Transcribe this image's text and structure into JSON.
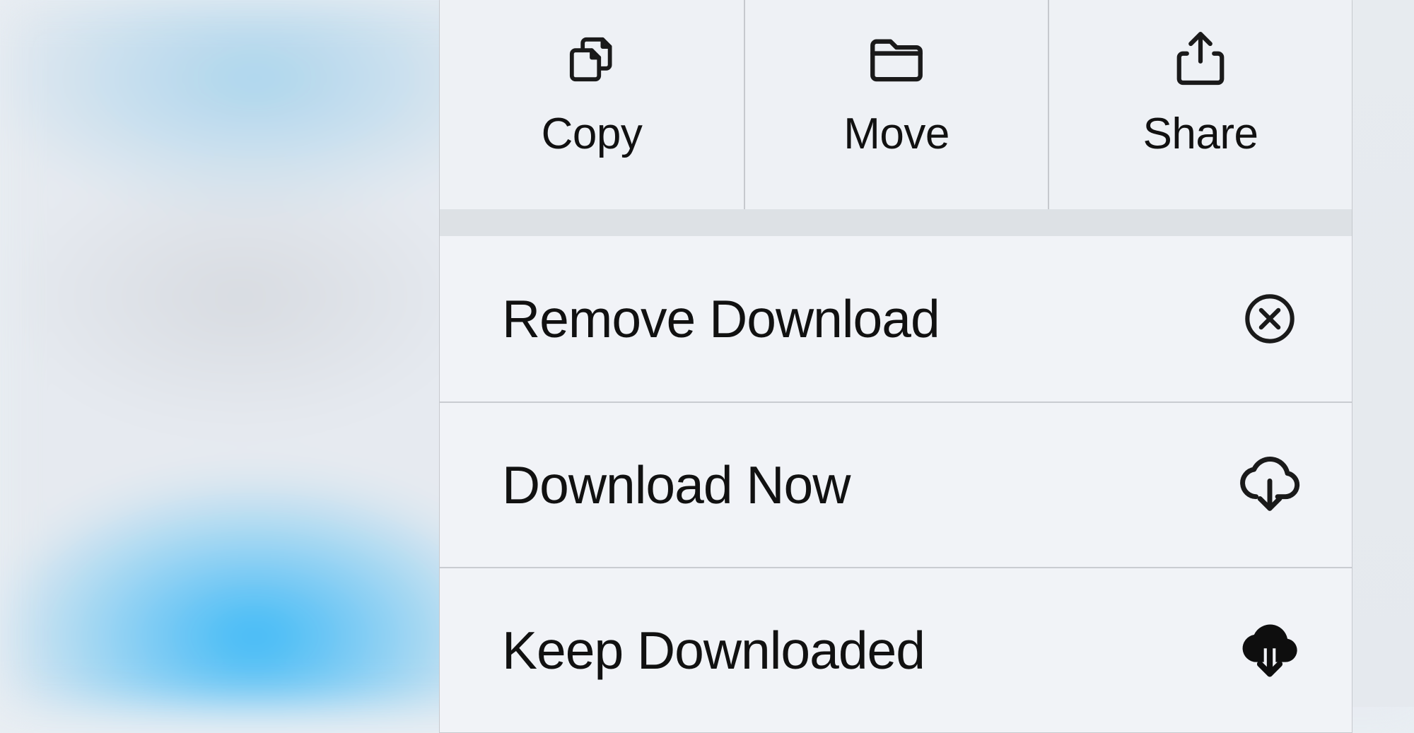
{
  "menu": {
    "top": {
      "copy": {
        "label": "Copy",
        "icon": "copy-icon"
      },
      "move": {
        "label": "Move",
        "icon": "folder-icon"
      },
      "share": {
        "label": "Share",
        "icon": "share-icon"
      }
    },
    "rows": {
      "remove_download": {
        "label": "Remove Download",
        "icon": "x-circle-icon"
      },
      "download_now": {
        "label": "Download Now",
        "icon": "cloud-download-icon"
      },
      "keep_downloaded": {
        "label": "Keep Downloaded",
        "icon": "cloud-download-filled-icon"
      }
    }
  }
}
